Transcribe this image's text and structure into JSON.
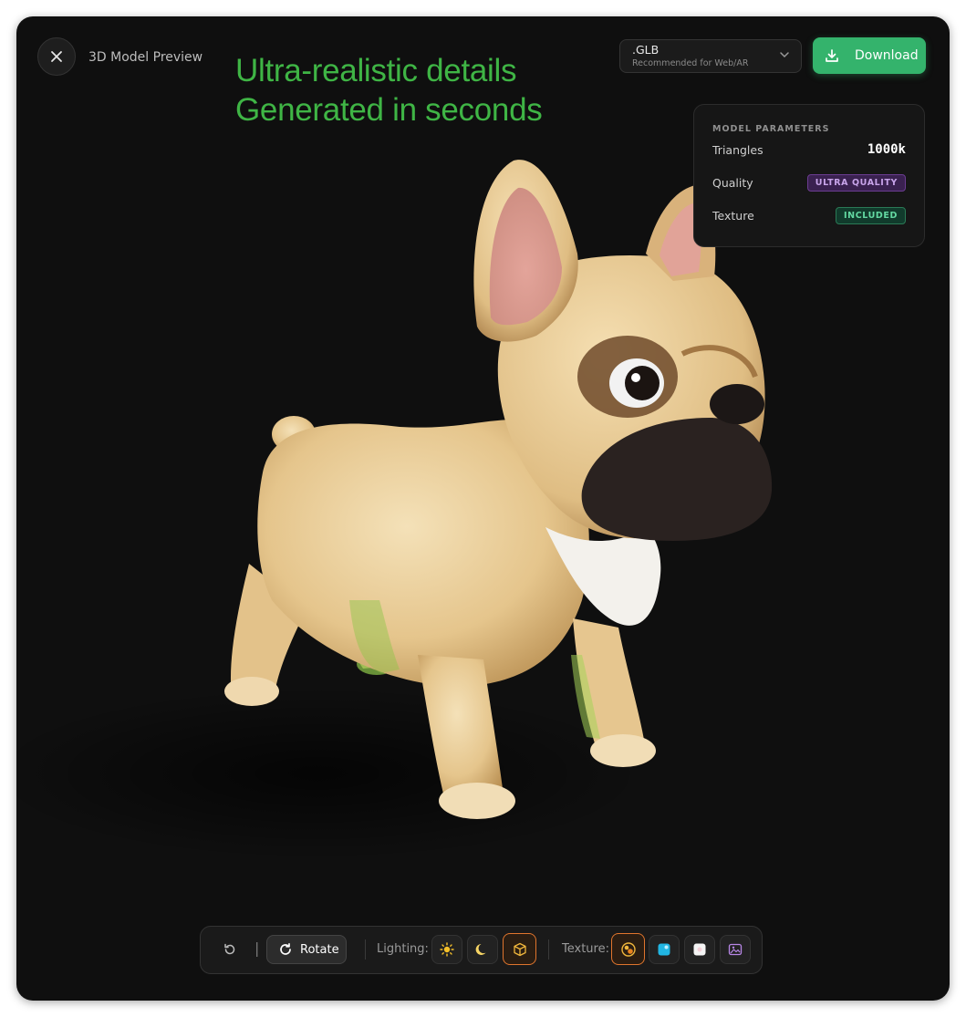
{
  "header": {
    "title": "3D Model Preview",
    "hero_line1": "Ultra-realistic details",
    "hero_line2": "Generated in seconds"
  },
  "format_select": {
    "value": ".GLB",
    "subtitle": "Recommended for Web/AR"
  },
  "download": {
    "label": "Download"
  },
  "params": {
    "heading": "MODEL PARAMETERS",
    "rows": [
      {
        "label": "Triangles",
        "value": "1000k"
      },
      {
        "label": "Quality",
        "value": "ULTRA QUALITY"
      },
      {
        "label": "Texture",
        "value": "INCLUDED"
      }
    ]
  },
  "toolbar": {
    "separator": "|",
    "rotate_label": "Rotate",
    "lighting_label": "Lighting:",
    "texture_label": "Texture:",
    "lighting_options": [
      "sun-icon",
      "moon-icon",
      "cube-icon"
    ],
    "texture_options": [
      "color-texture-icon",
      "cyan-texture-icon",
      "white-texture-icon",
      "image-upload-icon"
    ]
  },
  "colors": {
    "accent_green": "#34b36c",
    "hero_green": "#3fb545",
    "active_orange": "#e0752d"
  }
}
